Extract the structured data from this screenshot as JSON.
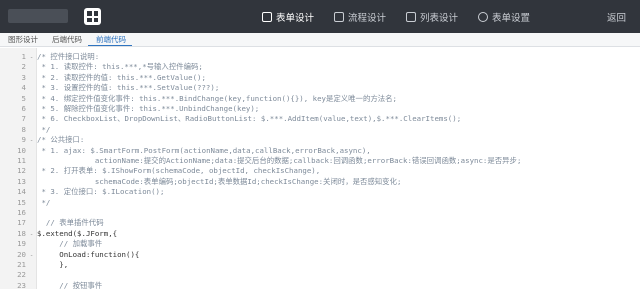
{
  "header": {
    "nav": [
      {
        "label": "表单设计",
        "active": true,
        "icon": "form-icon"
      },
      {
        "label": "流程设计",
        "active": false,
        "icon": "flow-icon"
      },
      {
        "label": "列表设计",
        "active": false,
        "icon": "list-icon"
      },
      {
        "label": "表单设置",
        "active": false,
        "icon": "settings-icon"
      }
    ],
    "right": {
      "back": "返回"
    }
  },
  "subtabs": [
    {
      "label": "图形设计",
      "active": false
    },
    {
      "label": "后端代码",
      "active": false
    },
    {
      "label": "前端代码",
      "active": true
    }
  ],
  "editor": {
    "lines": [
      {
        "n": "1",
        "fold": "-",
        "text": "/* 控件接口说明:",
        "style": "cm"
      },
      {
        "n": "2",
        "fold": "",
        "text": " * 1. 读取控件: this.***,*号输入控件编码;",
        "style": "cm"
      },
      {
        "n": "3",
        "fold": "",
        "text": " * 2. 读取控件的值: this.***.GetValue();",
        "style": "cm"
      },
      {
        "n": "4",
        "fold": "",
        "text": " * 3. 设置控件的值: this.***.SetValue(???);",
        "style": "cm"
      },
      {
        "n": "5",
        "fold": "",
        "text": " * 4. 绑定控件值变化事件: this.***.BindChange(key,function(){}), key是定义唯一的方法名;",
        "style": "cm"
      },
      {
        "n": "6",
        "fold": "",
        "text": " * 5. 解除控件值变化事件: this.***.UnbindChange(key);",
        "style": "cm"
      },
      {
        "n": "7",
        "fold": "",
        "text": " * 6. CheckboxList、DropDownList、RadioButtonList: $.***.AddItem(value,text),$.***.ClearItems();",
        "style": "cm"
      },
      {
        "n": "8",
        "fold": "",
        "text": " */",
        "style": "cm"
      },
      {
        "n": "9",
        "fold": "-",
        "text": "/* 公共接口:",
        "style": "cm"
      },
      {
        "n": "10",
        "fold": "",
        "text": " * 1. ajax: $.SmartForm.PostForm(actionName,data,callBack,errorBack,async),",
        "style": "cm"
      },
      {
        "n": "11",
        "fold": "",
        "text": "             actionName:提交的ActionName;data:提交后台的数据;callback:回调函数;errorBack:错误回调函数;async:是否异步;",
        "style": "cm"
      },
      {
        "n": "12",
        "fold": "",
        "text": " * 2. 打开表单: $.IShowForm(schemaCode, objectId, checkIsChange),",
        "style": "cm"
      },
      {
        "n": "13",
        "fold": "",
        "text": "             schemaCode:表单编码;objectId;表单数据Id;checkIsChange:关闭时，是否感知变化;",
        "style": "cm"
      },
      {
        "n": "14",
        "fold": "",
        "text": " * 3. 定位接口: $.ILocation();",
        "style": "cm"
      },
      {
        "n": "15",
        "fold": "",
        "text": " */",
        "style": "cm"
      },
      {
        "n": "16",
        "fold": "",
        "text": "",
        "style": "cm"
      },
      {
        "n": "17",
        "fold": "",
        "text": "  // 表单插件代码",
        "style": "cm"
      },
      {
        "n": "18",
        "fold": "-",
        "text": "$.extend($.JForm,{",
        "style": "kw"
      },
      {
        "n": "19",
        "fold": "",
        "text": "     // 加载事件",
        "style": "cm"
      },
      {
        "n": "20",
        "fold": "-",
        "text": "     OnLoad:function(){",
        "style": "kw"
      },
      {
        "n": "21",
        "fold": "",
        "text": "     },",
        "style": "kw"
      },
      {
        "n": "22",
        "fold": "",
        "text": "",
        "style": "cm"
      },
      {
        "n": "23",
        "fold": "",
        "text": "     // 按钮事件",
        "style": "cm"
      }
    ]
  }
}
